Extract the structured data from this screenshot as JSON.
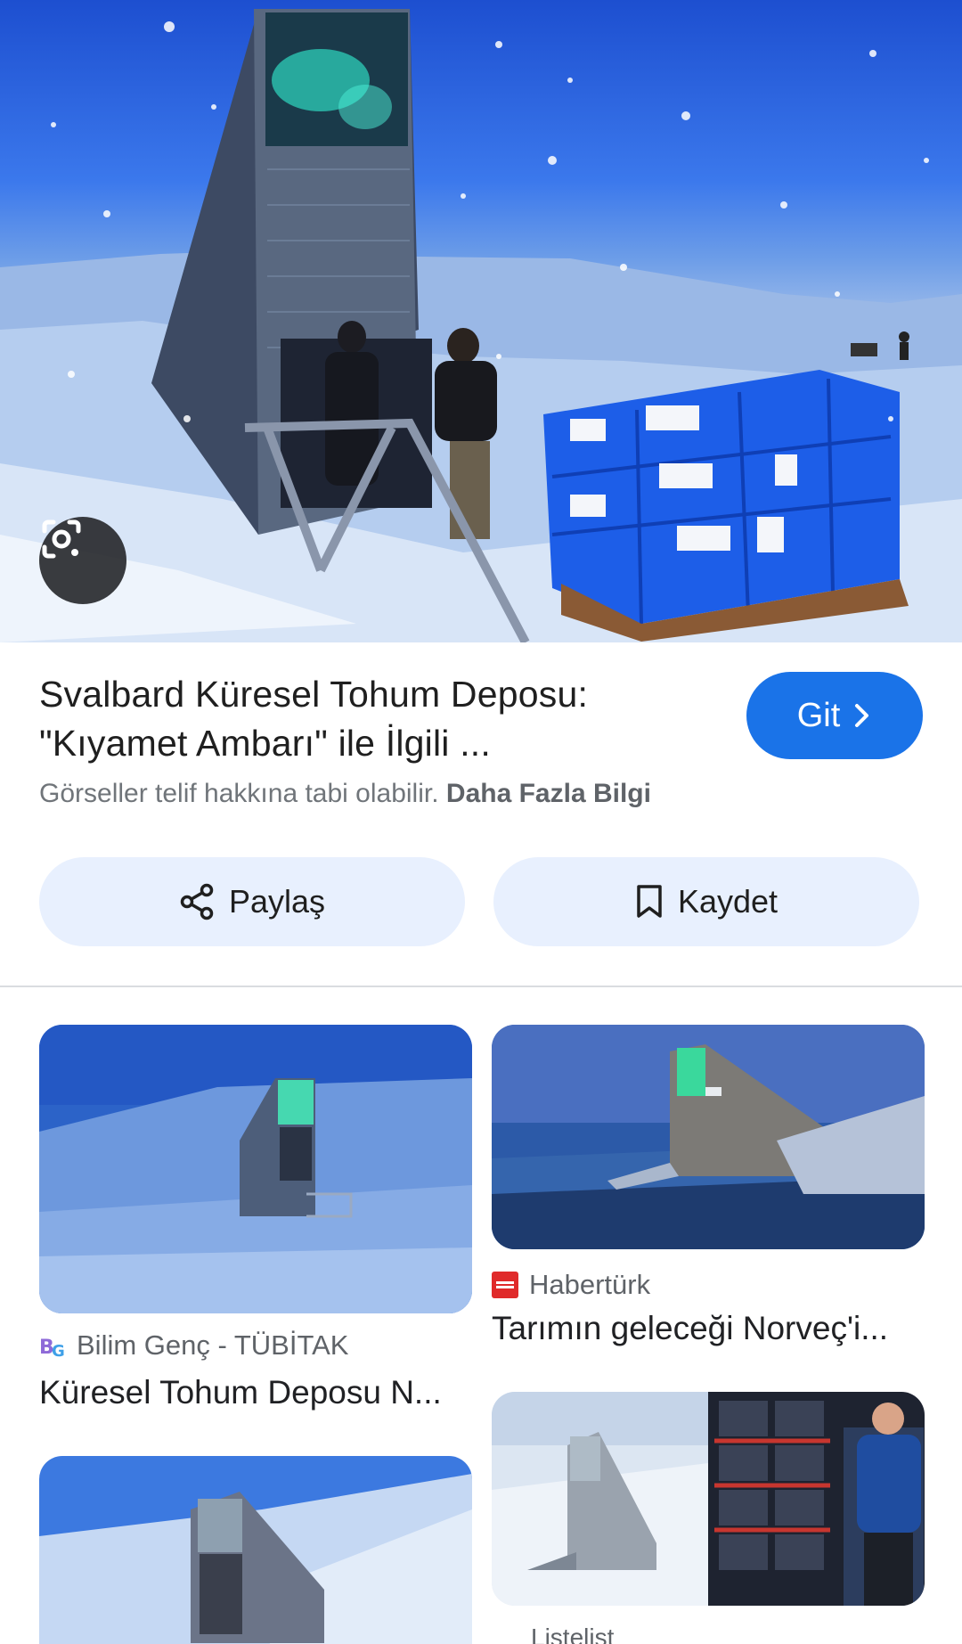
{
  "hero": {
    "lens_label": "Google Lens"
  },
  "result": {
    "title_line1": "Svalbard Küresel Tohum Deposu:",
    "title_line2": "\"Kıyamet Ambarı\" ile İlgili ...",
    "go_label": "Git",
    "copyright_text": "Görseller telif hakkına tabi olabilir.",
    "more_info_label": "Daha Fazla Bilgi"
  },
  "actions": {
    "share_label": "Paylaş",
    "save_label": "Kaydet"
  },
  "related": [
    {
      "source": "Bilim Genç - TÜBİTAK",
      "caption": "Küresel Tohum Deposu N..."
    },
    {
      "source": "Habertürk",
      "caption": "Tarımın geleceği Norveç'i..."
    },
    {
      "source": "",
      "caption": ""
    },
    {
      "source": "",
      "caption": ""
    }
  ],
  "bottom_partial_text": "Listelist",
  "colors": {
    "accent": "#1a73e8",
    "action_bg": "#e8f0fe",
    "divider": "#dadce0"
  }
}
